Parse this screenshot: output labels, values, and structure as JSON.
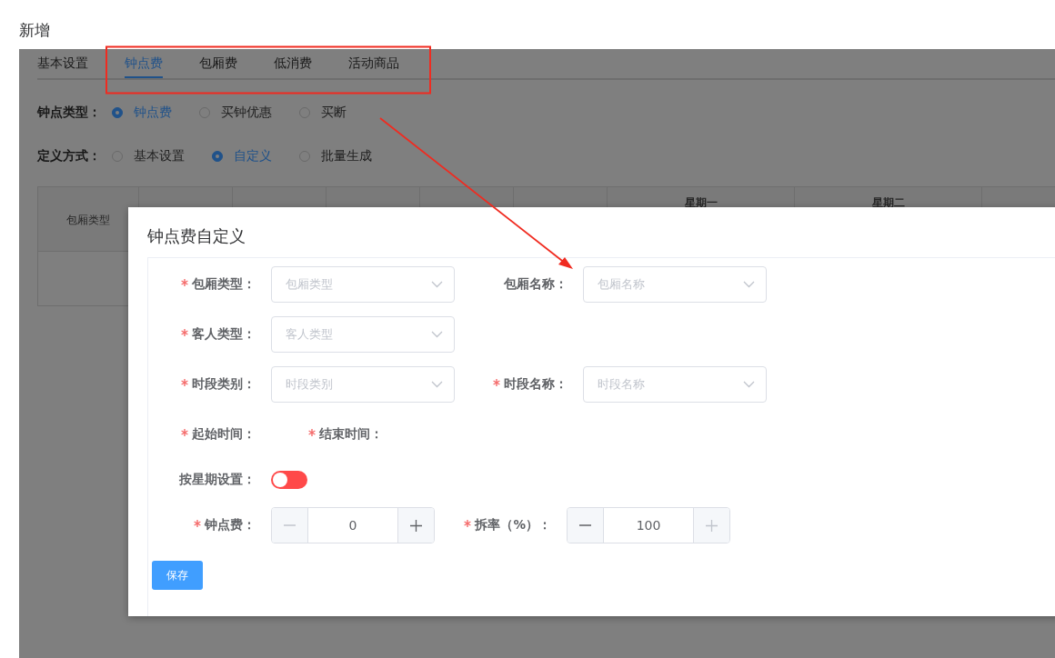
{
  "dialog_title": "新增",
  "tabs": [
    {
      "label": "基本设置",
      "selected": false
    },
    {
      "label": "钟点费",
      "selected": true
    },
    {
      "label": "包厢费",
      "selected": false
    },
    {
      "label": "低消费",
      "selected": false
    },
    {
      "label": "活动商品",
      "selected": false
    }
  ],
  "radio_groups": [
    {
      "label": "钟点类型：",
      "options": [
        {
          "label": "钟点费",
          "selected": true
        },
        {
          "label": "买钟优惠",
          "selected": false
        },
        {
          "label": "买断",
          "selected": false
        }
      ]
    },
    {
      "label": "定义方式：",
      "options": [
        {
          "label": "基本设置",
          "selected": false
        },
        {
          "label": "自定义",
          "selected": true
        },
        {
          "label": "批量生成",
          "selected": false
        }
      ]
    }
  ],
  "table": {
    "columns": [
      {
        "label": "包厢类型"
      },
      {
        "label": "星期一"
      },
      {
        "label": "星期二"
      }
    ]
  },
  "modal": {
    "title": "钟点费自定义",
    "rows": [
      {
        "items": [
          {
            "kind": "select",
            "label": "包厢类型：",
            "required": true,
            "placeholder": "包厢类型"
          },
          {
            "kind": "select",
            "label": "包厢名称：",
            "required": false,
            "placeholder": "包厢名称"
          }
        ]
      },
      {
        "items": [
          {
            "kind": "select",
            "label": "客人类型：",
            "required": true,
            "placeholder": "客人类型"
          }
        ]
      },
      {
        "items": [
          {
            "kind": "select",
            "label": "时段类别：",
            "required": true,
            "placeholder": "时段类别"
          },
          {
            "kind": "select",
            "label": "时段名称：",
            "required": true,
            "placeholder": "时段名称"
          }
        ]
      },
      {
        "items": [
          {
            "kind": "time",
            "label": "起始时间：",
            "required": true
          },
          {
            "kind": "time",
            "label": "结束时间：",
            "required": true
          }
        ]
      },
      {
        "items": [
          {
            "kind": "switch",
            "label": "按星期设置：",
            "required": false,
            "on": false
          }
        ]
      },
      {
        "items": [
          {
            "kind": "number",
            "label": "钟点费：",
            "required": true,
            "value": "0",
            "decrease_disabled": true,
            "increase_disabled": false
          },
          {
            "kind": "number",
            "label": "拆率（%）：",
            "required": true,
            "value": "100",
            "decrease_disabled": false,
            "increase_disabled": true
          }
        ]
      }
    ],
    "save_button": "保存"
  }
}
